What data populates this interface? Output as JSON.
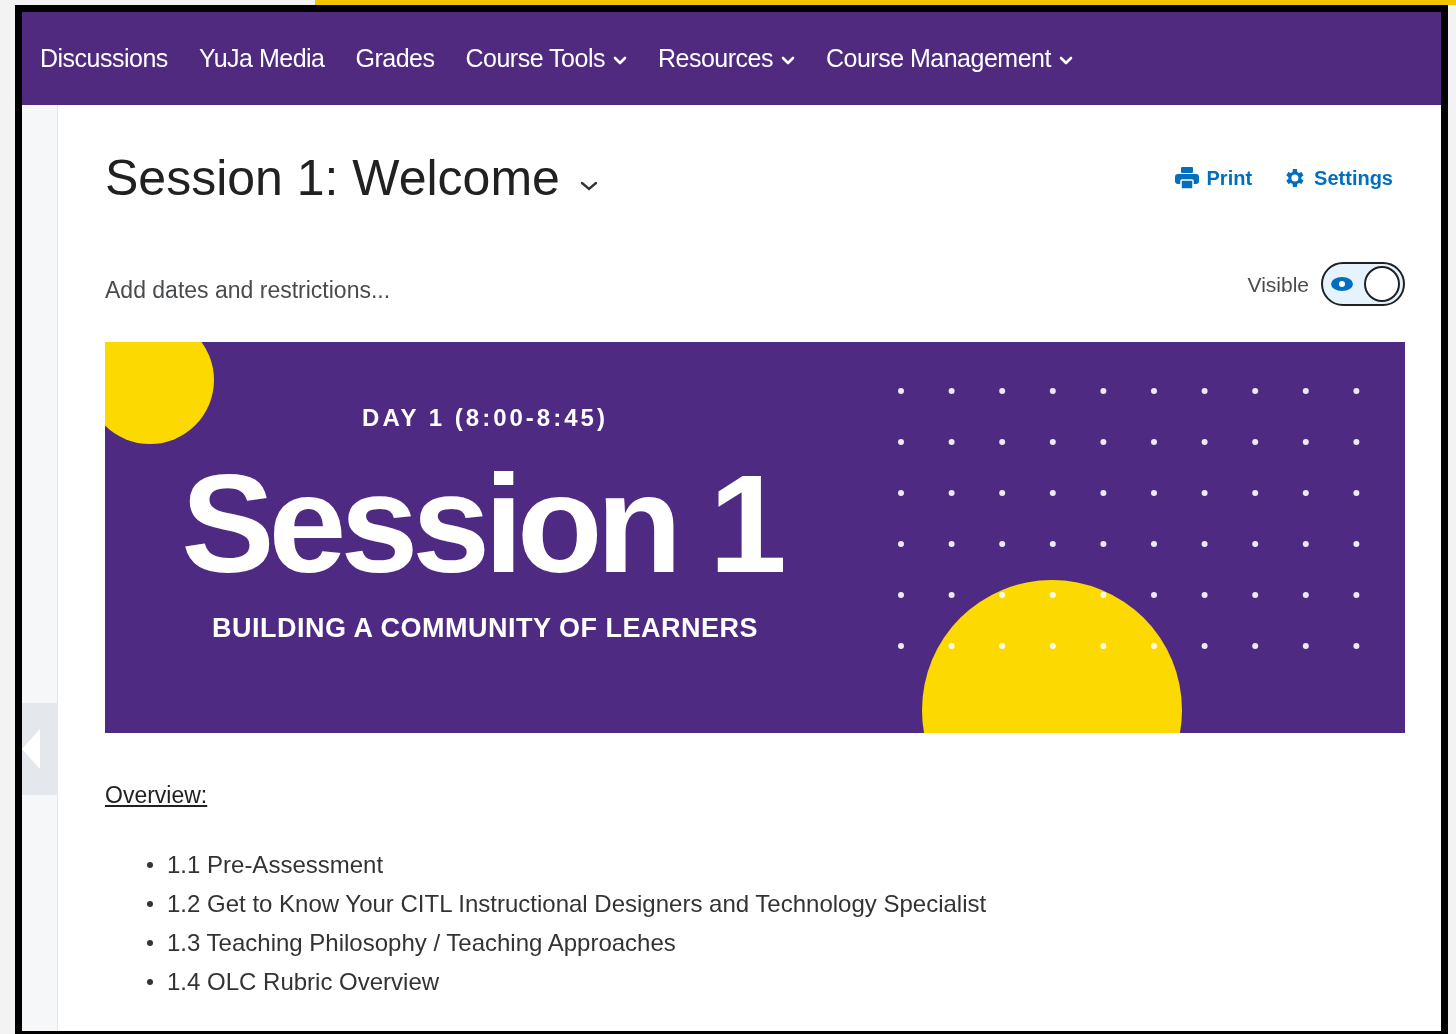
{
  "nav": [
    {
      "label": "Discussions",
      "dropdown": false
    },
    {
      "label": "YuJa Media",
      "dropdown": false
    },
    {
      "label": "Grades",
      "dropdown": false
    },
    {
      "label": "Course Tools",
      "dropdown": true
    },
    {
      "label": "Resources",
      "dropdown": true
    },
    {
      "label": "Course Management",
      "dropdown": true
    }
  ],
  "page": {
    "title": "Session 1: Welcome",
    "actions": [
      "Print",
      "Settings"
    ],
    "dates_link": "Add dates and restrictions...",
    "visibility": {
      "label": "Visible",
      "on": true
    }
  },
  "banner": {
    "kicker": "DAY 1 (8:00-8:45)",
    "headline": "Session 1",
    "subtitle": "BUILDING A COMMUNITY OF LEARNERS"
  },
  "overview": {
    "heading": "Overview:",
    "items": [
      "1.1 Pre-Assessment",
      "1.2 Get to Know Your CITL Instructional Designers and Technology Specialist",
      "1.3 Teaching Philosophy / Teaching Approaches",
      "1.4 OLC Rubric Overview"
    ]
  }
}
